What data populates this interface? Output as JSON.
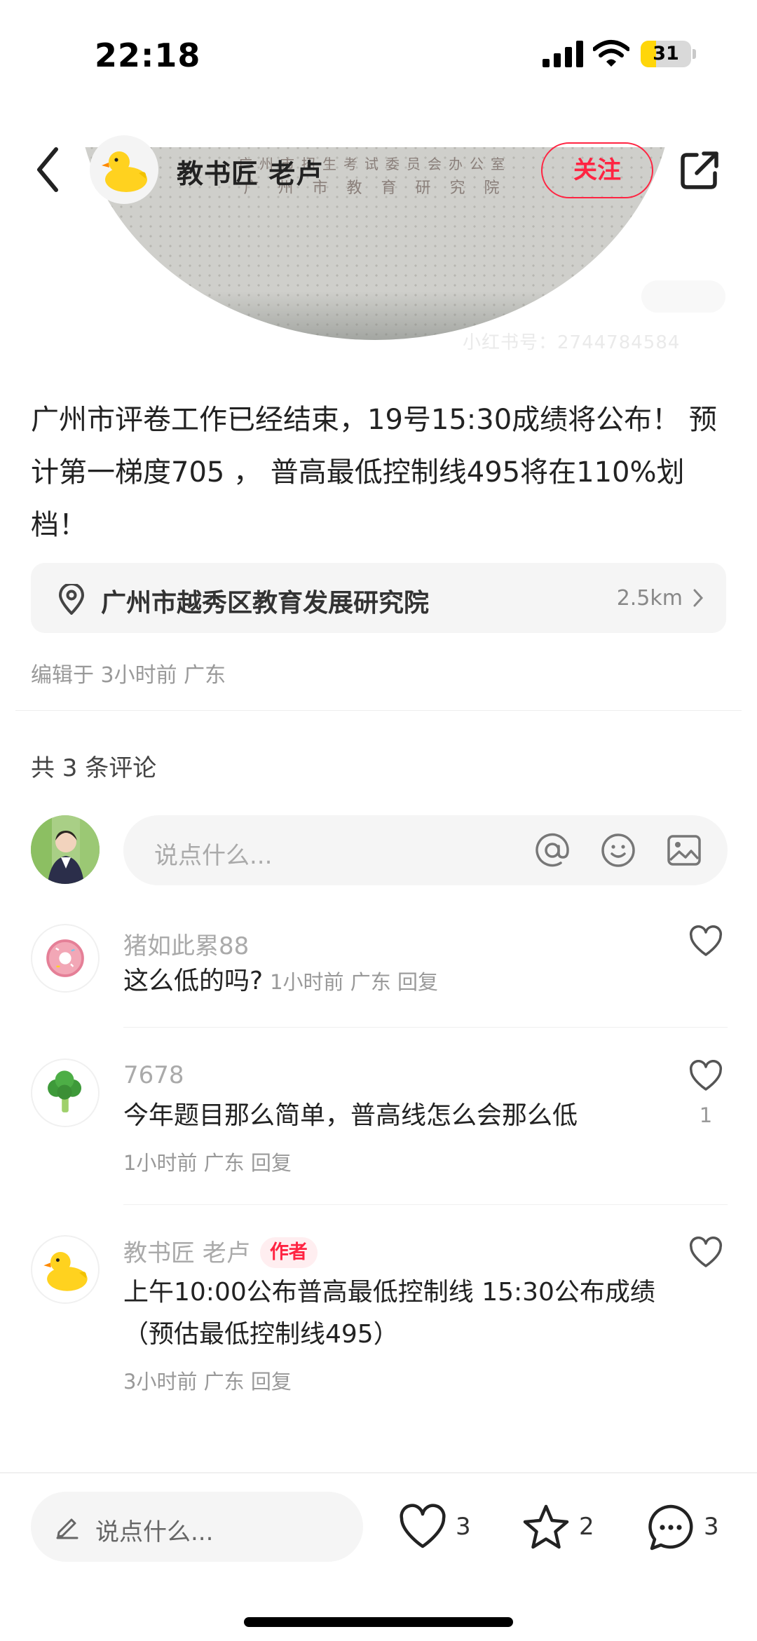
{
  "status_bar": {
    "time": "22:18",
    "battery": "31",
    "battery_level": 0.31
  },
  "photo": {
    "line1": "广州市招生考试委员会办公室",
    "line2": "广 州 市 教 育 研 究 院",
    "watermark": "小红书号：2744784584"
  },
  "header": {
    "author_name": "教书匠 老卢",
    "follow_label": "关注"
  },
  "post": {
    "text": "广州市评卷工作已经结束，19号15:30成绩将公布！ 预计第一梯度705 ， 普高最低控制线495将在110%划档！",
    "location": {
      "name": "广州市越秀区教育发展研究院",
      "distance": "2.5km"
    },
    "edit_info": "编辑于 3小时前 广东"
  },
  "comments_section": {
    "count_label": "共 3 条评论",
    "input_placeholder": "说点什么...",
    "comments": [
      {
        "user": "猪如此累88",
        "text": "这么低的吗?",
        "meta": "1小时前 广东 回复",
        "likes": ""
      },
      {
        "user": "7678",
        "text": "今年题目那么简单，普高线怎么会那么低",
        "meta": "1小时前 广东 回复",
        "likes": "1"
      },
      {
        "user": "教书匠 老卢",
        "tag": "作者",
        "text": "上午10:00公布普高最低控制线 15:30公布成绩（预估最低控制线495）",
        "meta": "3小时前 广东 回复",
        "likes": ""
      }
    ]
  },
  "bottom_bar": {
    "placeholder": "说点什么...",
    "likes": "3",
    "stars": "2",
    "comments": "3"
  },
  "colors": {
    "accent": "#ff2442",
    "muted": "#999999",
    "surface": "#f5f5f5"
  },
  "icons": [
    "back-icon",
    "share-icon",
    "pin-icon",
    "at-icon",
    "emoji-icon",
    "image-icon",
    "heart-icon",
    "star-icon",
    "comment-bubble-icon",
    "pencil-icon"
  ]
}
